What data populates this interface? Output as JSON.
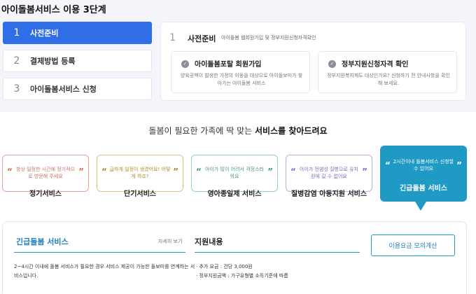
{
  "page_title": "아이돌봄서비스 이용 3단계",
  "steps": [
    {
      "num": "1",
      "label": "사전준비"
    },
    {
      "num": "2",
      "label": "결제방법 등록"
    },
    {
      "num": "3",
      "label": "아이돌봄서비스 신청"
    }
  ],
  "detail": {
    "num": "1",
    "title": "사전준비",
    "subtitle": "아이돌봄 웹회원가입 및 정부지원신청자격확인",
    "cards": [
      {
        "icon": "check-icon",
        "title": "아이돌봄포탈 회원가입",
        "desc": "양육공백이 발생한 가정의 아동을 대상으로 아이돌보미가 찾아가는 아이돌봄 서비스"
      },
      {
        "icon": "check-icon",
        "title": "정부지원신청자격 확인",
        "desc": "정부지원복지제도 대상인가요? 신청하기 전 안내사항을 확인해 보세요."
      }
    ]
  },
  "headline": {
    "pre": "돌봄이 필요한 가족에 딱 맞는 ",
    "bold": "서비스를 찾아드려요"
  },
  "quote_open": "“",
  "quote_close": "”",
  "services": [
    {
      "desc": "항상 일정한 시간에 정기적으로 방문해 주세요",
      "name": "정기서비스",
      "color": "#c9735f"
    },
    {
      "desc": "급하게 일정이 생겼어요! 어떻게 하죠?",
      "name": "단기서비스",
      "color": "#b08c2d"
    },
    {
      "desc": "아이가 많이 어려서 걱정스러워요",
      "name": "영아종일제 서비스",
      "color": "#4c9b72"
    },
    {
      "desc": "아이가 전염성 질병으로 유치원에 갈 수 없어요",
      "name": "질병감염 아동지원 서비스",
      "color": "#7a6fc0"
    },
    {
      "desc": "2시간이내 돌봄서비스 신청할 수 있어요",
      "name": "긴급돌봄 서비스",
      "color": "#1f9ac4"
    }
  ],
  "info": {
    "title": "긴급돌봄 서비스",
    "more": "자세히 보기",
    "text": "2~4시간 이내에 돌봄 서비스가 필요한 경우 서비스 제공이 가능한 돌보미를 연계하는 서비스입니다.",
    "support_title": "지원내용",
    "support_items": [
      "추가 요금 : 건당 3,000원",
      "정부지원금액 : 가구유형별 소득기준에 따름"
    ],
    "calc_button": "이용요금 모의계산"
  }
}
